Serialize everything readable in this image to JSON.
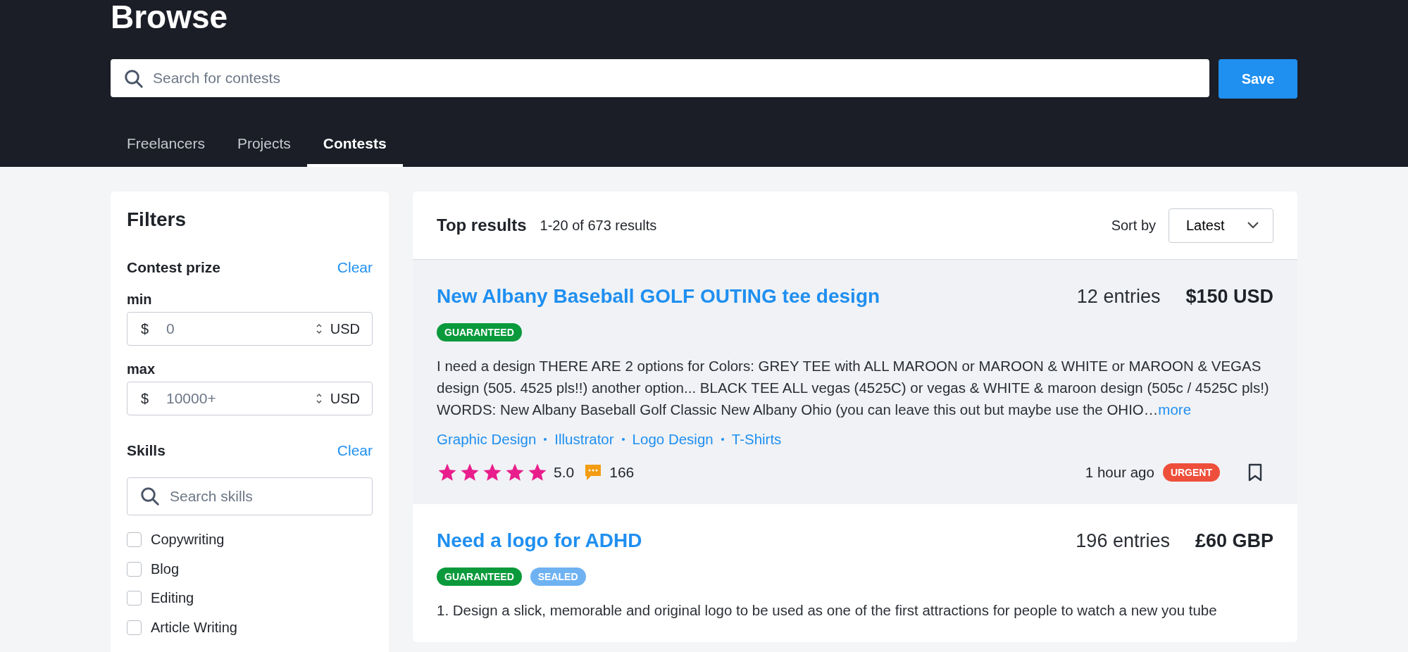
{
  "header": {
    "title": "Browse",
    "search": {
      "placeholder": "Search for contests"
    },
    "save_button": "Save"
  },
  "tabs": [
    {
      "label": "Freelancers",
      "selected": false
    },
    {
      "label": "Projects",
      "selected": false
    },
    {
      "label": "Contests",
      "selected": true
    }
  ],
  "filters": {
    "title": "Filters",
    "contest_prize": {
      "title": "Contest prize",
      "clear": "Clear",
      "fields": [
        {
          "label": "min",
          "prefix": "$",
          "placeholder": "0",
          "suffix": "USD"
        },
        {
          "label": "max",
          "prefix": "$",
          "placeholder": "10000+",
          "suffix": "USD"
        }
      ]
    },
    "skills": {
      "title": "Skills",
      "clear": "Clear",
      "search": {
        "placeholder": "Search skills"
      },
      "items": [
        {
          "label": "Copywriting",
          "checked": false
        },
        {
          "label": "Blog",
          "checked": false
        },
        {
          "label": "Editing",
          "checked": false
        },
        {
          "label": "Article Writing",
          "checked": false
        }
      ]
    }
  },
  "results": {
    "title": "Top results",
    "count": "1-20 of 673 results",
    "sort_label": "Sort by",
    "sort_value": "Latest",
    "contests": [
      {
        "title": "New Albany Baseball GOLF OUTING tee design",
        "entries": "12 entries",
        "prize": "$150 USD",
        "highlighted": true,
        "badges": [
          {
            "kind": "guaranteed",
            "label": "GUARANTEED"
          }
        ],
        "description": "I need a design THERE ARE 2 options for Colors: GREY TEE with ALL MAROON or MAROON & WHITE or MAROON & VEGAS design (505. 4525 pls!!) another option... BLACK TEE ALL vegas (4525C) or vegas & WHITE & maroon design (505c / 4525C pls!) WORDS: New Albany Baseball Golf Classic New Albany Ohio (you can leave this out but maybe use the OHIO…",
        "more": "more",
        "tags": [
          "Graphic Design",
          "Illustrator",
          "Logo Design",
          "T-Shirts"
        ],
        "stars": 5,
        "rating": "5.0",
        "comments": "166",
        "posted": "1 hour ago",
        "status_badges": [
          {
            "kind": "urgent",
            "label": "URGENT"
          }
        ],
        "bookmarked": false
      },
      {
        "title": "Need a logo for ADHD",
        "entries": "196 entries",
        "prize": "£60 GBP",
        "highlighted": false,
        "badges": [
          {
            "kind": "guaranteed",
            "label": "GUARANTEED"
          },
          {
            "kind": "sealed",
            "label": "SEALED"
          }
        ],
        "description": "1. Design a slick, memorable and original logo to be used as one of the first attractions for people to watch a new you tube"
      }
    ]
  }
}
